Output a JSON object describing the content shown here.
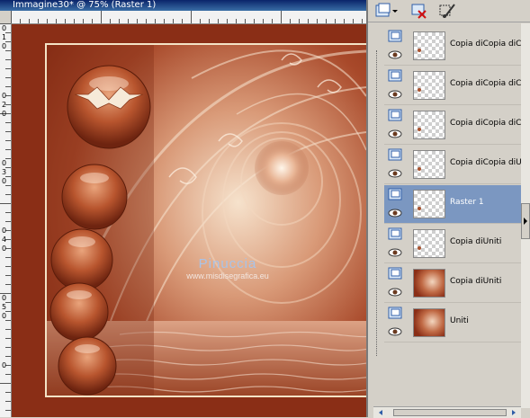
{
  "document": {
    "title": "Immagine30* @ 75% (Raster 1)",
    "watermark": {
      "line1": "Pinuccia",
      "line2": "www.misdisegrafica.eu"
    },
    "vruler_labels": [
      "0",
      "1",
      "0",
      "0",
      "2",
      "0",
      "0",
      "3",
      "0",
      "0",
      "4",
      "0",
      "0",
      "5",
      "0",
      "0"
    ],
    "colors": {
      "background": "#8a2e16",
      "frame": "#f4e3c6",
      "accent": "#c9784e"
    }
  },
  "palette": {
    "toolbar": {
      "new_layer_icon": "new-layer-icon",
      "delete_icon": "delete-layer-icon",
      "edit_icon": "brush-icon"
    },
    "layers": [
      {
        "name": "Copia diCopia diCopia",
        "thumb": "transparent",
        "selected": false
      },
      {
        "name": "Copia diCopia diCopia",
        "thumb": "transparent",
        "selected": false
      },
      {
        "name": "Copia diCopia diCopia",
        "thumb": "transparent",
        "selected": false
      },
      {
        "name": "Copia diCopia diUniti",
        "thumb": "transparent",
        "selected": false
      },
      {
        "name": "Raster 1",
        "thumb": "transparent",
        "selected": true
      },
      {
        "name": "Copia diUniti",
        "thumb": "transparent",
        "selected": false
      },
      {
        "name": "Copia diUniti",
        "thumb": "image",
        "selected": false
      },
      {
        "name": "Uniti",
        "thumb": "image",
        "selected": false
      }
    ]
  }
}
